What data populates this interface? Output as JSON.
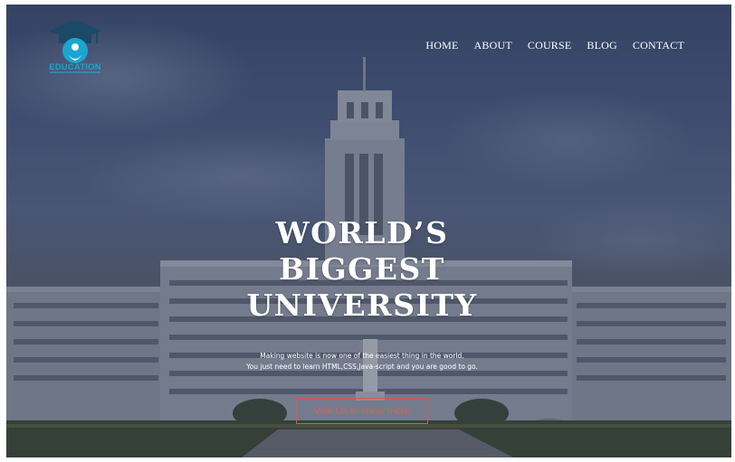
{
  "brand": {
    "name": "EDUCATION",
    "accent": "#1aa6cf"
  },
  "nav": {
    "items": [
      "HOME",
      "ABOUT",
      "COURSE",
      "BLOG",
      "CONTACT"
    ]
  },
  "hero": {
    "title_line1": "WORLD’S",
    "title_line2": "BIGGEST",
    "title_line3": "UNIVERSITY",
    "desc_line1": "Making website is now one of the easiest thing in the world.",
    "desc_line2": "You just need to learn HTML,CSS,Java-script and you are good to go.",
    "cta_label": "Visit Us to konw more",
    "cta_color": "#e05454"
  },
  "icons": {
    "logo": "graduation-cap-person-icon"
  }
}
